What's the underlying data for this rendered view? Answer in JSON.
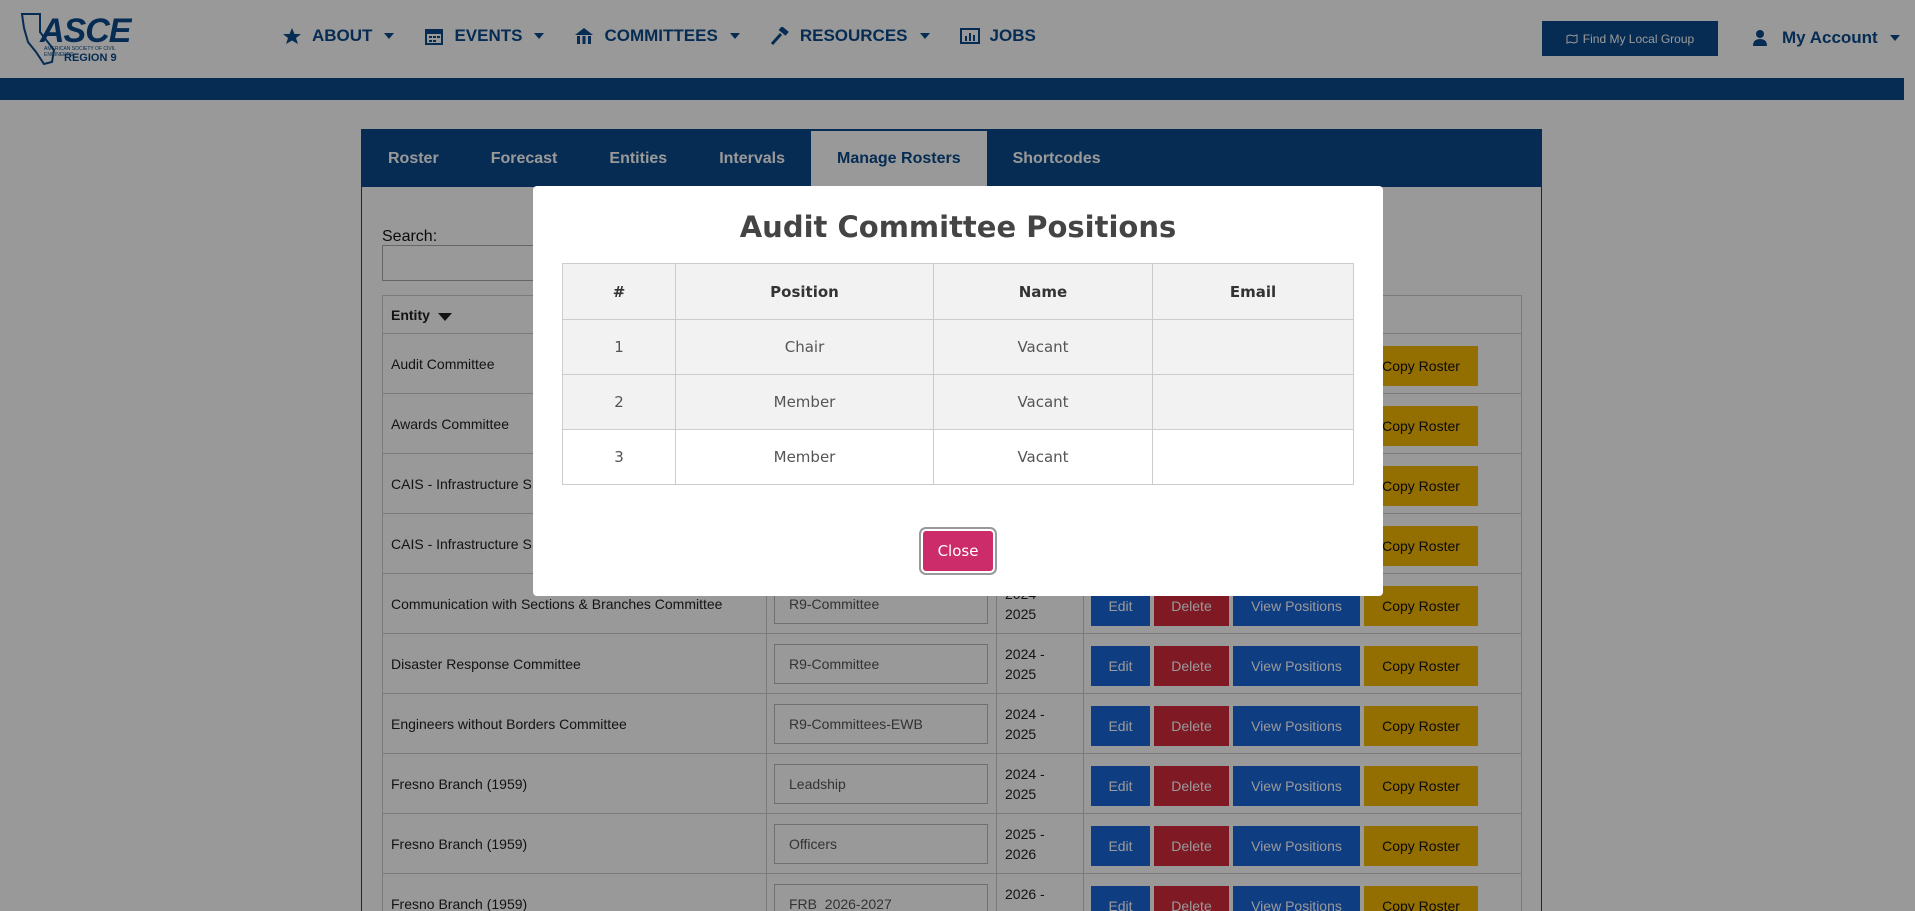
{
  "header": {
    "logo_text": "ASCE",
    "logo_tagline": "AMERICAN SOCIETY OF CIVIL ENGINEERS",
    "logo_region": "REGION 9",
    "nav": [
      {
        "label": "ABOUT",
        "icon": "star-icon",
        "caret": true
      },
      {
        "label": "EVENTS",
        "icon": "calendar-icon",
        "caret": true
      },
      {
        "label": "COMMITTEES",
        "icon": "people-icon",
        "caret": true
      },
      {
        "label": "RESOURCES",
        "icon": "hammer-icon",
        "caret": true
      },
      {
        "label": "JOBS",
        "icon": "chart-icon",
        "caret": false
      }
    ],
    "find_group": "Find My Local Group",
    "account": "My Account"
  },
  "tabs": [
    "Roster",
    "Forecast",
    "Entities",
    "Intervals",
    "Manage Rosters",
    "Shortcodes"
  ],
  "active_tab": "Manage Rosters",
  "search": {
    "label": "Search:",
    "value": ""
  },
  "table": {
    "entity_header": "Entity",
    "buttons": {
      "edit": "Edit",
      "delete": "Delete",
      "view": "View Positions",
      "copy": "Copy Roster"
    },
    "rows": [
      {
        "entity": "Audit Committee",
        "group": "",
        "interval_a": "",
        "interval_b": ""
      },
      {
        "entity": "Awards Committee",
        "group": "",
        "interval_a": "",
        "interval_b": ""
      },
      {
        "entity": "CAIS - Infrastructure S",
        "group": "",
        "interval_a": "",
        "interval_b": ""
      },
      {
        "entity": "CAIS - Infrastructure S",
        "group": "",
        "interval_a": "",
        "interval_b": ""
      },
      {
        "entity": "Communication with Sections & Branches Committee",
        "group": "R9-Committee",
        "interval_a": "2024 -",
        "interval_b": "2025"
      },
      {
        "entity": "Disaster Response Committee",
        "group": "R9-Committee",
        "interval_a": "2024 -",
        "interval_b": "2025"
      },
      {
        "entity": "Engineers without Borders Committee",
        "group": "R9-Committees-EWB",
        "interval_a": "2024 -",
        "interval_b": "2025"
      },
      {
        "entity": "Fresno Branch (1959)",
        "group": "Leadship",
        "interval_a": "2024 -",
        "interval_b": "2025"
      },
      {
        "entity": "Fresno Branch (1959)",
        "group": "Officers",
        "interval_a": "2025 -",
        "interval_b": "2026"
      },
      {
        "entity": "Fresno Branch (1959)",
        "group": "FRB_2026-2027",
        "interval_a": "2026 -",
        "interval_b": ""
      }
    ]
  },
  "modal": {
    "title": "Audit Committee Positions",
    "columns": [
      "#",
      "Position",
      "Name",
      "Email"
    ],
    "rows": [
      {
        "num": "1",
        "position": "Chair",
        "name": "Vacant",
        "email": ""
      },
      {
        "num": "2",
        "position": "Member",
        "name": "Vacant",
        "email": ""
      },
      {
        "num": "3",
        "position": "Member",
        "name": "Vacant",
        "email": ""
      }
    ],
    "close_label": "Close"
  },
  "colors": {
    "brand_blue": "#0a4a8c",
    "edit_blue": "#1a66d9",
    "delete_red": "#d42a3c",
    "copy_yellow": "#f5b800",
    "close_pink": "#cc2d6a"
  }
}
